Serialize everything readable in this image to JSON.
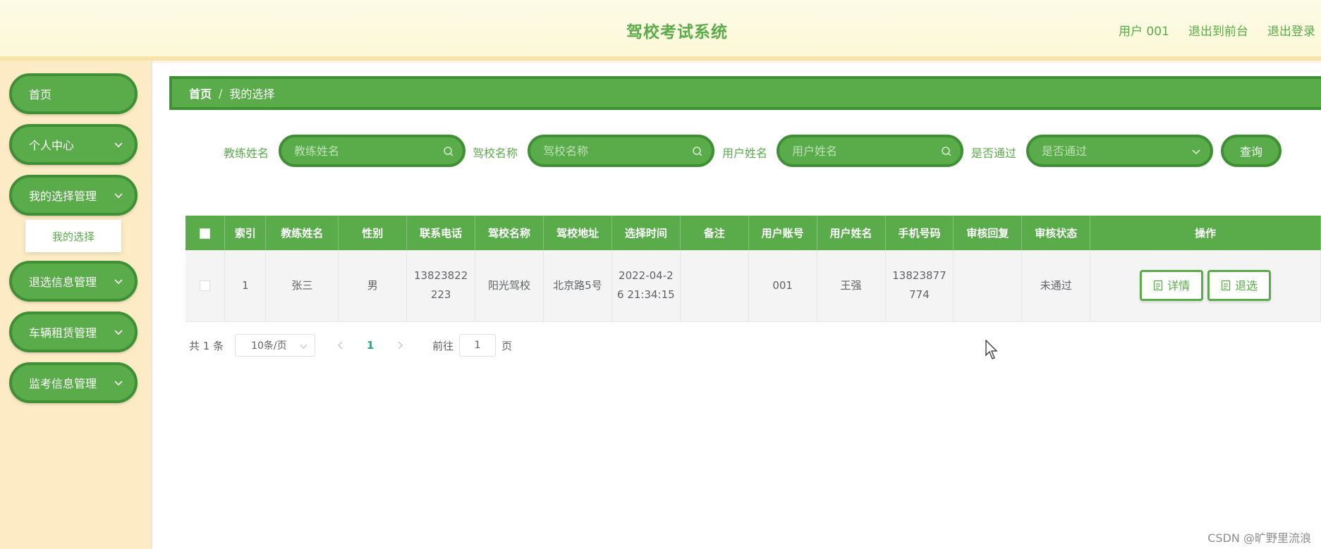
{
  "header": {
    "title": "驾校考试系统",
    "links": [
      "用户 001",
      "退出到前台",
      "退出登录"
    ]
  },
  "sidebar": {
    "items": [
      {
        "label": "首页",
        "has_children": false
      },
      {
        "label": "个人中心",
        "has_children": true
      },
      {
        "label": "我的选择管理",
        "has_children": true
      },
      {
        "label": "退选信息管理",
        "has_children": true
      },
      {
        "label": "车辆租赁管理",
        "has_children": true
      },
      {
        "label": "监考信息管理",
        "has_children": true
      }
    ],
    "submenu": {
      "label": "我的选择"
    }
  },
  "breadcrumb": {
    "home": "首页",
    "separator": "/",
    "current": "我的选择"
  },
  "search": {
    "fields": [
      {
        "label": "教练姓名",
        "placeholder": "教练姓名",
        "icon": "search-icon"
      },
      {
        "label": "驾校名称",
        "placeholder": "驾校名称",
        "icon": "search-icon"
      },
      {
        "label": "用户姓名",
        "placeholder": "用户姓名",
        "icon": "search-icon"
      },
      {
        "label": "是否通过",
        "placeholder": "是否通过",
        "icon": "chevron-down-icon"
      }
    ],
    "query_label": "查询"
  },
  "table": {
    "columns": [
      "索引",
      "教练姓名",
      "性别",
      "联系电话",
      "驾校名称",
      "驾校地址",
      "选择时间",
      "备注",
      "用户账号",
      "用户姓名",
      "手机号码",
      "审核回复",
      "审核状态",
      "操作"
    ],
    "rows": [
      {
        "index": "1",
        "coach_name": "张三",
        "gender": "男",
        "phone": "13823822223",
        "school_name": "阳光驾校",
        "school_address": "北京路5号",
        "select_time": "2022-04-26 21:34:15",
        "remark": "",
        "user_account": "001",
        "user_name": "王强",
        "mobile": "13823877774",
        "review_reply": "",
        "review_status": "未通过"
      }
    ],
    "actions": {
      "detail": "详情",
      "withdraw": "退选"
    }
  },
  "pagination": {
    "total": "共 1 条",
    "page_size": "10条/页",
    "current_page": "1",
    "goto_label": "前往",
    "goto_value": "1",
    "page_suffix": "页"
  },
  "watermark": "CSDN @旷野里流浪",
  "colors": {
    "accent": "#5aab4a",
    "accent_dark": "#3f8f35",
    "sidebar_bg": "#fdebc5",
    "header_bg": "#fdf8d8"
  }
}
